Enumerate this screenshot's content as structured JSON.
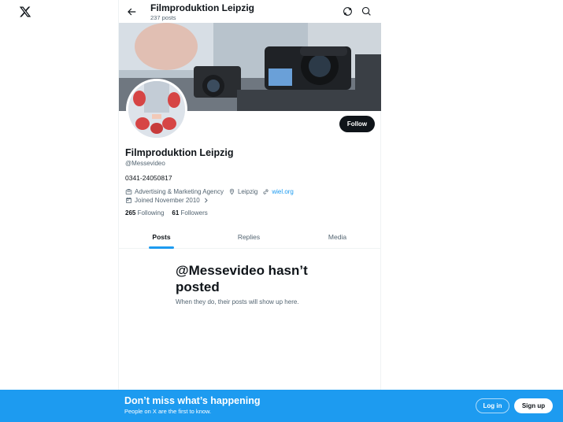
{
  "header": {
    "title": "Filmproduktion Leipzig",
    "posts_count": "237 posts"
  },
  "profile": {
    "name": "Filmproduktion Leipzig",
    "handle": "@Messevideo",
    "bio": "0341-24050817",
    "category": "Advertising & Marketing Agency",
    "location": "Leipzig",
    "website": "wiel.org",
    "joined": "Joined November 2010",
    "following_count": "265",
    "following_label": "Following",
    "followers_count": "61",
    "followers_label": "Followers",
    "follow_label": "Follow"
  },
  "tabs": [
    {
      "label": "Posts",
      "active": true
    },
    {
      "label": "Replies",
      "active": false
    },
    {
      "label": "Media",
      "active": false
    }
  ],
  "empty_state": {
    "title": "@Messevideo hasn’t posted",
    "subtitle": "When they do, their posts will show up here."
  },
  "bottom_bar": {
    "title": "Don’t miss what’s happening",
    "subtitle": "People on X are the first to know.",
    "login_label": "Log in",
    "signup_label": "Sign up"
  },
  "icons": {
    "logo": "x-logo-icon",
    "back": "arrow-left-icon",
    "refresh": "refresh-icon",
    "search": "search-icon",
    "category": "briefcase-icon",
    "location": "location-pin-icon",
    "website": "link-icon",
    "joined": "calendar-icon"
  },
  "colors": {
    "accent": "#1d9bf0",
    "text": "#0f1419",
    "muted": "#536471"
  }
}
